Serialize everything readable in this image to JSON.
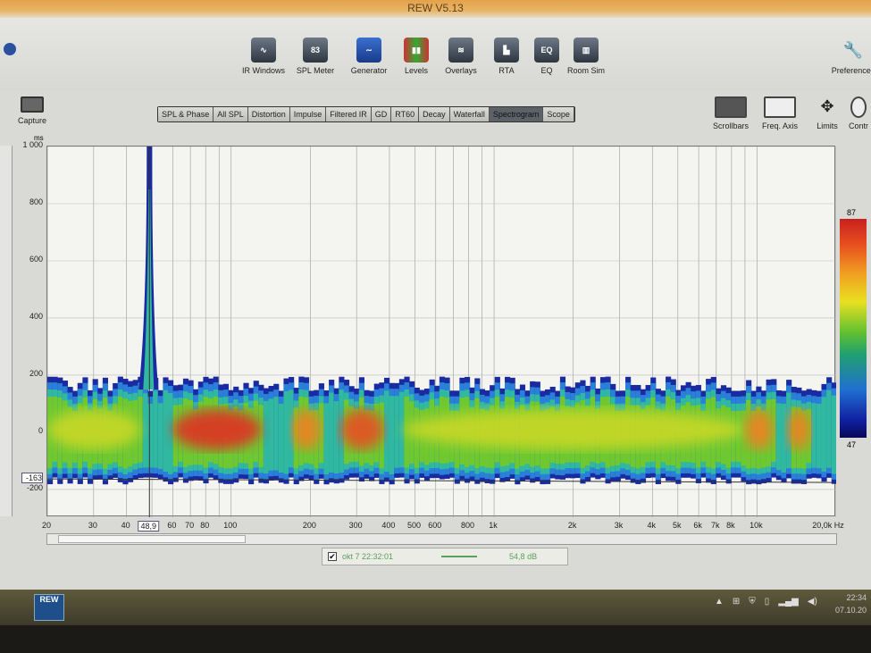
{
  "window": {
    "title": "REW V5.13"
  },
  "toolbar": {
    "items": [
      {
        "label": "IR Windows",
        "icon": "ir-windows-icon",
        "glyph": "∿"
      },
      {
        "label": "SPL Meter",
        "icon": "spl-meter-icon",
        "glyph": "83"
      },
      {
        "label": "Generator",
        "icon": "generator-icon",
        "glyph": "∼"
      },
      {
        "label": "Levels",
        "icon": "levels-icon",
        "glyph": "▮▮"
      },
      {
        "label": "Overlays",
        "icon": "overlays-icon",
        "glyph": "≋"
      },
      {
        "label": "RTA",
        "icon": "rta-icon",
        "glyph": "▙"
      },
      {
        "label": "EQ",
        "icon": "eq-icon",
        "glyph": "EQ"
      },
      {
        "label": "Room Sim",
        "icon": "room-sim-icon",
        "glyph": "▥"
      }
    ],
    "preferences": "Preferences",
    "capture": "Capture"
  },
  "tabs": [
    "SPL & Phase",
    "All SPL",
    "Distortion",
    "Impulse",
    "Filtered IR",
    "GD",
    "RT60",
    "Decay",
    "Waterfall",
    "Spectrogram",
    "Scope"
  ],
  "active_tab": "Spectrogram",
  "right_tools": [
    "Scrollbars",
    "Freq. Axis",
    "Limits",
    "Contr"
  ],
  "chart_data": {
    "type": "heatmap",
    "title": "Spectrogram",
    "ylabel": "ms",
    "xlabel": "Hz",
    "xlim": [
      20,
      20000
    ],
    "ylim": [
      -297,
      1000
    ],
    "x_ticks": [
      "20",
      "30",
      "40",
      "60",
      "70",
      "80",
      "100",
      "200",
      "300",
      "400",
      "500",
      "600",
      "800",
      "1k",
      "2k",
      "3k",
      "4k",
      "5k",
      "6k",
      "7k",
      "8k",
      "10k",
      "20,0k Hz"
    ],
    "x_tick_values": [
      20,
      30,
      40,
      60,
      70,
      80,
      100,
      200,
      300,
      400,
      500,
      600,
      800,
      1000,
      2000,
      3000,
      4000,
      5000,
      6000,
      7000,
      8000,
      10000,
      20000
    ],
    "y_ticks": [
      1000,
      800,
      600,
      400,
      200,
      0,
      -200
    ],
    "cursor": {
      "freq_label": "48,9",
      "freq": 48.9,
      "time_label": "-163",
      "time": -163
    },
    "color_scale": {
      "max": "87",
      "min": "47"
    },
    "hotspots": [
      {
        "freq_range": [
          20,
          45
        ],
        "level": "green-yellow"
      },
      {
        "freq_range": [
          48.9,
          48.9
        ],
        "level": "blue-green",
        "duration_ms": 1000
      },
      {
        "freq_range": [
          60,
          130
        ],
        "level": "red"
      },
      {
        "freq_range": [
          170,
          220
        ],
        "level": "orange"
      },
      {
        "freq_range": [
          260,
          380
        ],
        "level": "red-orange"
      },
      {
        "freq_range": [
          450,
          9000
        ],
        "level": "green-yellow"
      },
      {
        "freq_range": [
          9000,
          11500
        ],
        "level": "orange"
      },
      {
        "freq_range": [
          13000,
          16000
        ],
        "level": "orange"
      }
    ]
  },
  "legend": {
    "checked": true,
    "label": "okt 7 22:32:01",
    "value": "54,8 dB",
    "color": "#5aa05a"
  },
  "taskbar": {
    "app": "REW",
    "time": "22:34",
    "date": "07.10.20"
  }
}
